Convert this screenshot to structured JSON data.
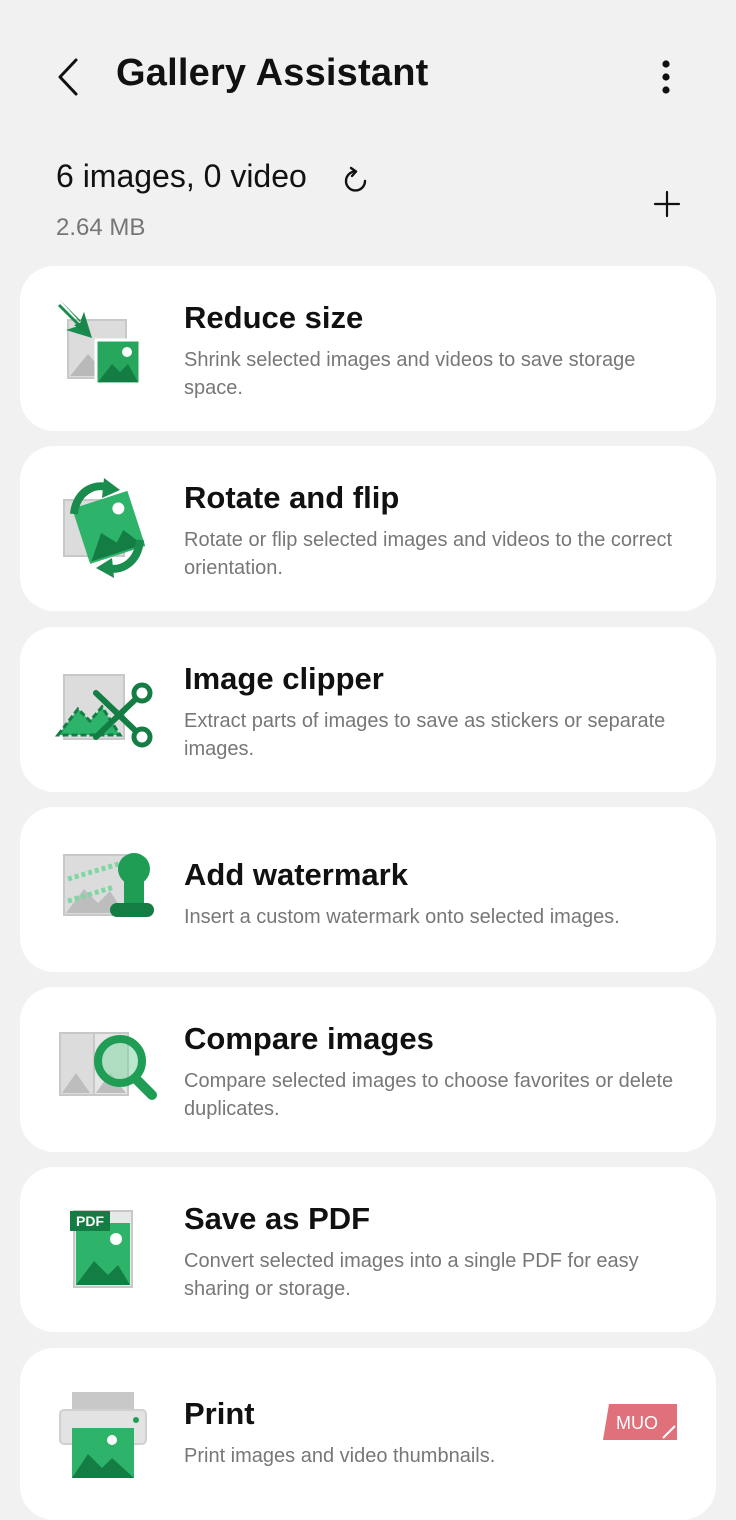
{
  "header": {
    "title": "Gallery Assistant"
  },
  "summary": {
    "counts": "6 images, 0 video",
    "size": "2.64 MB"
  },
  "tools": [
    {
      "title": "Reduce size",
      "description": "Shrink selected images and videos to save storage space.",
      "icon": "reduce-size-icon"
    },
    {
      "title": "Rotate and flip",
      "description": "Rotate or flip selected images and videos to the correct orientation.",
      "icon": "rotate-flip-icon"
    },
    {
      "title": "Image clipper",
      "description": "Extract parts of images to save as stickers or separate images.",
      "icon": "image-clipper-icon"
    },
    {
      "title": "Add watermark",
      "description": "Insert a custom watermark onto selected images.",
      "icon": "watermark-icon"
    },
    {
      "title": "Compare images",
      "description": "Compare selected images to choose favorites or delete duplicates.",
      "icon": "compare-images-icon"
    },
    {
      "title": "Save as PDF",
      "description": "Convert selected images into a single PDF for easy sharing or storage.",
      "icon": "pdf-icon"
    },
    {
      "title": "Print",
      "description": "Print images and video thumbnails.",
      "icon": "printer-icon"
    }
  ],
  "watermark_badge": "MUO",
  "colors": {
    "background": "#f1f1f1",
    "card": "#ffffff",
    "accent_green": "#1f9d55",
    "badge": "#e0707a"
  }
}
